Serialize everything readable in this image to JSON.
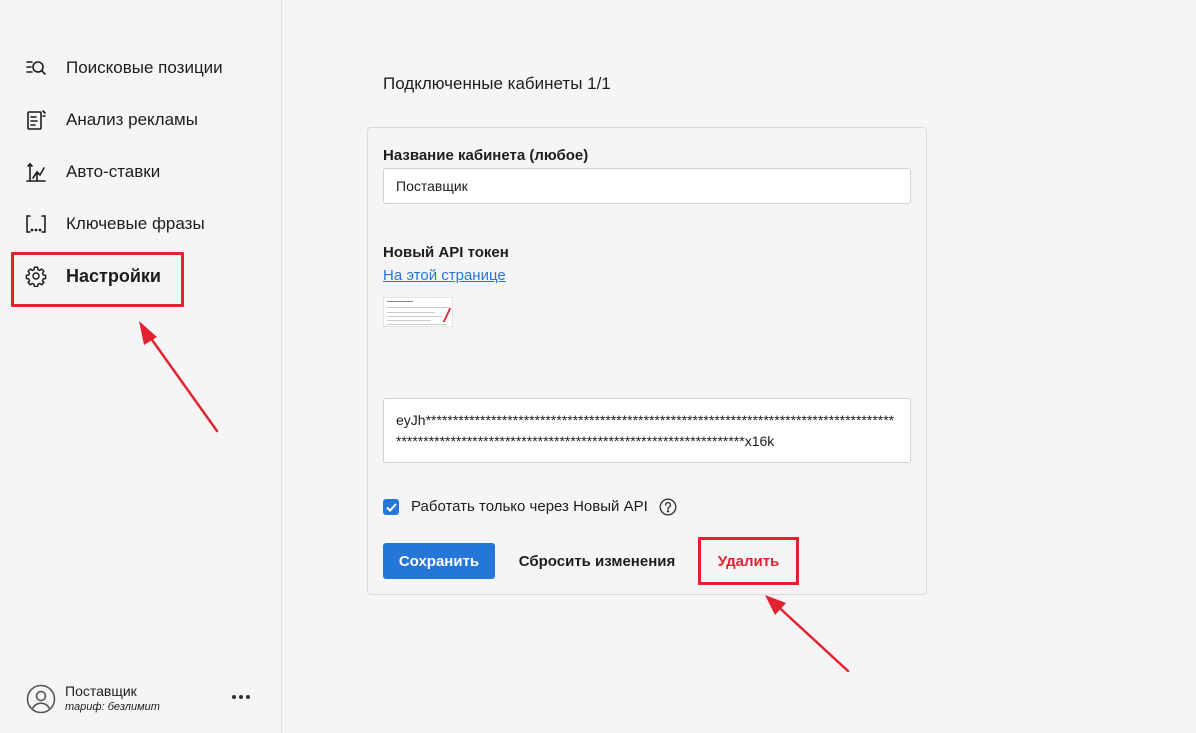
{
  "sidebar": {
    "items": [
      {
        "label": "Поисковые позиции",
        "icon": "search-positions-icon"
      },
      {
        "label": "Анализ рекламы",
        "icon": "ad-analysis-icon"
      },
      {
        "label": "Авто-ставки",
        "icon": "auto-bids-icon"
      },
      {
        "label": "Ключевые фразы",
        "icon": "keyphrases-icon"
      },
      {
        "label": "Настройки",
        "icon": "gear-icon",
        "active": true
      }
    ],
    "user": {
      "name": "Поставщик",
      "plan": "тариф: безлимит"
    }
  },
  "main": {
    "title": "Подключенные кабинеты 1/1",
    "form": {
      "name_label": "Название кабинета (любое)",
      "name_value": "Поставщик",
      "token_label": "Новый API токен",
      "token_link": "На этой странице",
      "token_value": "eyJh******************************************************************************************************************************************************x16k",
      "checkbox_label": "Работать только через Новый API",
      "checkbox_checked": true,
      "save_label": "Сохранить",
      "reset_label": "Сбросить изменения",
      "delete_label": "Удалить"
    }
  },
  "colors": {
    "accent": "#2476d9",
    "annotation": "#e2232f"
  }
}
